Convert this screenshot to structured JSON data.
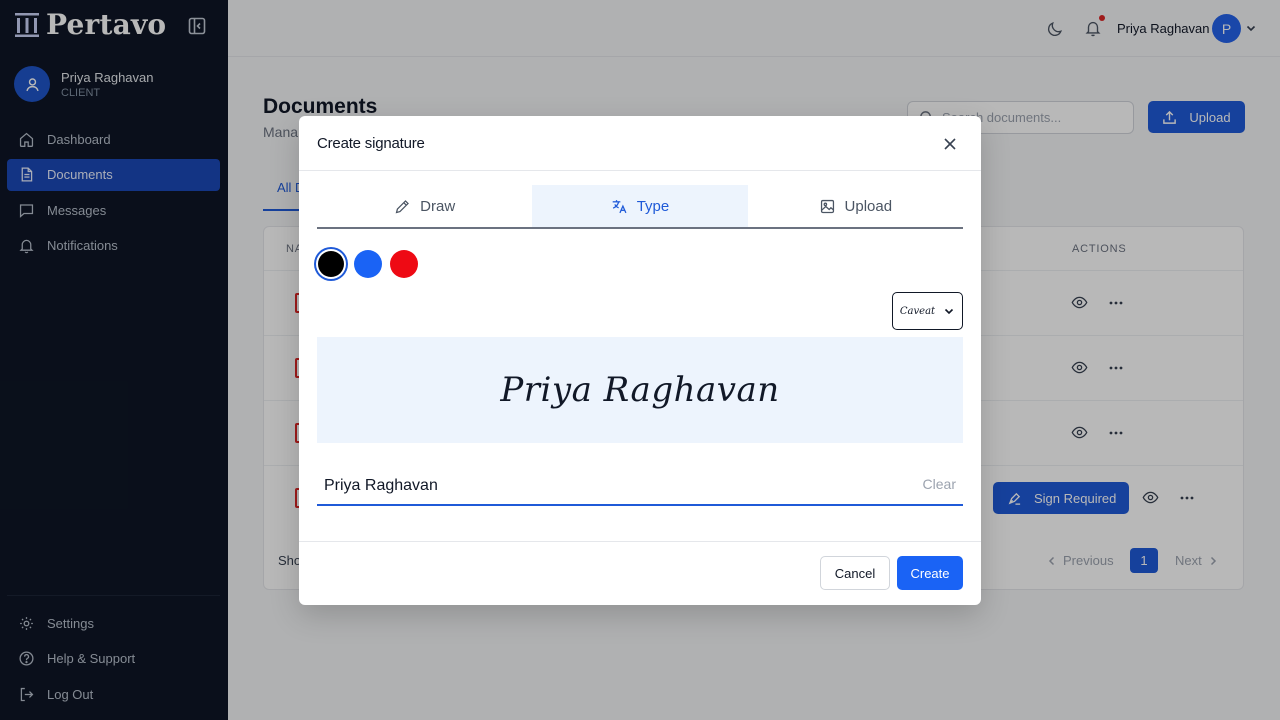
{
  "brand": {
    "name": "Pertavo",
    "logo_icon": "columns-logo-icon"
  },
  "sidebar": {
    "user": {
      "name": "Priya Raghavan",
      "role": "CLIENT"
    },
    "nav": [
      {
        "label": "Dashboard",
        "icon": "home-icon"
      },
      {
        "label": "Documents",
        "icon": "document-icon",
        "active": true
      },
      {
        "label": "Messages",
        "icon": "message-icon"
      },
      {
        "label": "Notifications",
        "icon": "bell-icon"
      }
    ],
    "bottom": [
      {
        "label": "Settings",
        "icon": "gear-icon"
      },
      {
        "label": "Help & Support",
        "icon": "help-icon"
      },
      {
        "label": "Log Out",
        "icon": "logout-icon"
      }
    ]
  },
  "topbar": {
    "user_name": "Priya Raghavan",
    "avatar_initial": "P"
  },
  "page": {
    "title": "Documents",
    "subtitle": "Mana",
    "search_placeholder": "Search documents...",
    "upload_label": "Upload",
    "tab_all": "All D",
    "table": {
      "col_name": "NA",
      "col_actions": "ACTIONS",
      "sign_required_label": "Sign Required",
      "footer_show": "Sho",
      "pagination": {
        "previous": "Previous",
        "current": "1",
        "next": "Next"
      }
    }
  },
  "modal": {
    "title": "Create signature",
    "tabs": [
      {
        "label": "Draw",
        "icon": "pencil-icon"
      },
      {
        "label": "Type",
        "icon": "translate-icon",
        "active": true
      },
      {
        "label": "Upload",
        "icon": "image-icon"
      }
    ],
    "colors": [
      "#000000",
      "#1a63f5",
      "#ee0a14"
    ],
    "selected_color": "#000000",
    "font_select": "Caveat",
    "preview_text": "Priya Raghavan",
    "name_value": "Priya Raghavan",
    "clear_label": "Clear",
    "cancel_label": "Cancel",
    "create_label": "Create"
  }
}
